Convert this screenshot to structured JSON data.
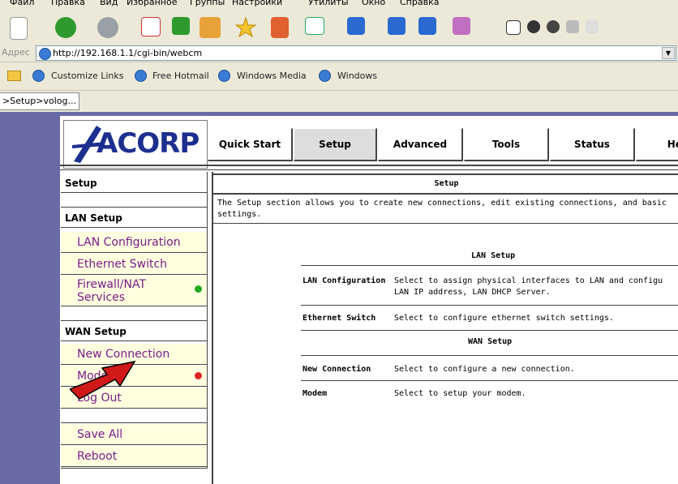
{
  "menu": [
    "Файл",
    "Правка",
    "Вид",
    "Избранное",
    "Группы",
    "Настройки",
    "Утилиты",
    "Окно",
    "Справка"
  ],
  "address": {
    "label": "Адрес",
    "url": "http://192.168.1.1/cgi-bin/webcm"
  },
  "links": [
    "Customize Links",
    "Free Hotmail",
    "Windows Media",
    "Windows"
  ],
  "tab": {
    "label": ">Setup>volog..."
  },
  "logo": {
    "text": "ACORP"
  },
  "nav": {
    "items": [
      "Quick Start",
      "Setup",
      "Advanced",
      "Tools",
      "Status",
      "Hel"
    ],
    "active": "Setup"
  },
  "sidebar": {
    "setup_title": "Setup",
    "lan_title": "LAN Setup",
    "lan_items": [
      "LAN Configuration",
      "Ethernet Switch",
      "Firewall/NAT Services"
    ],
    "wan_title": "WAN Setup",
    "wan_items": [
      "New Connection",
      "Modem"
    ],
    "logout": "Log Out",
    "save_all": "Save All",
    "reboot": "Reboot"
  },
  "status_colors": {
    "firewall": "#22aa22",
    "modem": "#dd2222"
  },
  "content": {
    "title": "Setup",
    "description": "The Setup section allows you to create new connections, edit existing connections, and basic settings.",
    "lan_heading": "LAN Setup",
    "lan_rows": [
      {
        "name": "LAN Configuration",
        "desc": "Select to assign physical interfaces to LAN and configu LAN IP address, LAN DHCP Server."
      },
      {
        "name": "Ethernet Switch",
        "desc": "Select to configure ethernet switch settings."
      }
    ],
    "wan_heading": "WAN Setup",
    "wan_rows": [
      {
        "name": "New Connection",
        "desc": "Select to configure a new connection."
      },
      {
        "name": "Modem",
        "desc": "Select to setup your modem."
      }
    ]
  }
}
